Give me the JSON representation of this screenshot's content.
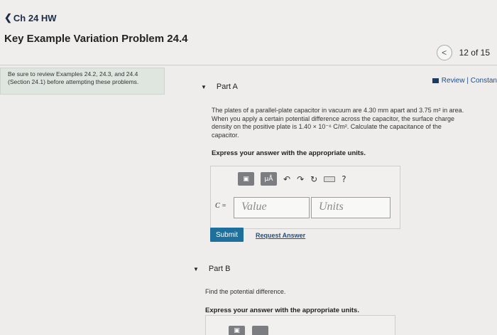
{
  "header": {
    "back_label": "Ch 24 HW",
    "assignment_title": "Key Example Variation Problem 24.4",
    "pager_text": "12 of 15"
  },
  "note": {
    "line1": "Be sure to review Examples 24.2, 24.3, and 24.4",
    "line2": "(Section 24.1) before attempting these problems."
  },
  "review_label": "Review | Constan",
  "partA": {
    "title": "Part A",
    "problem_l1": "The plates of a parallel-plate capacitor in vacuum are 4.30 mm apart and 3.75 m² in area.",
    "problem_l2": "When you apply a certain potential difference across the capacitor, the surface charge",
    "problem_l3": "density on the positive plate is 1.40 × 10⁻⁶ C/m². Calculate the capacitance of the",
    "problem_l4": "capacitor.",
    "express": "Express your answer with the appropriate units.",
    "toolbar": {
      "micro_label": "μÅ",
      "undo": "↶",
      "redo": "↷",
      "reset": "↻",
      "help": "?"
    },
    "var_label": "C =",
    "value_placeholder": "Value",
    "units_placeholder": "Units",
    "submit_label": "Submit",
    "request_label": "Request Answer"
  },
  "partB": {
    "title": "Part B",
    "problem": "Find the potential difference.",
    "express": "Express your answer with the appropriate units."
  },
  "colors": {
    "submit": "#1f6f9d",
    "link": "#1d4f8a",
    "note_bg": "#dfe6df"
  }
}
